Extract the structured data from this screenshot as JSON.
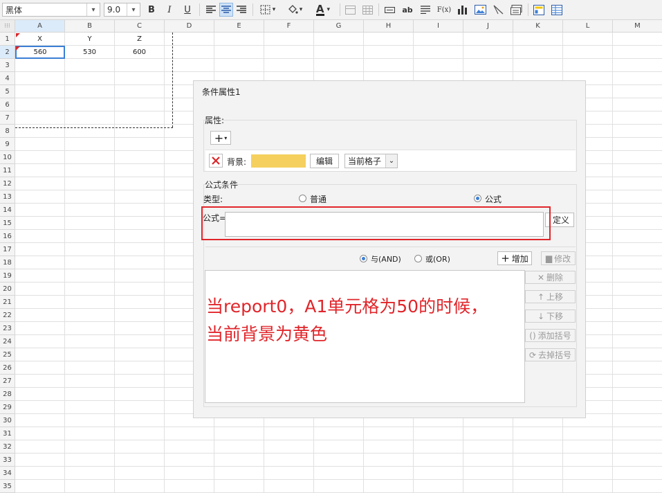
{
  "toolbar": {
    "font_name": "黑体",
    "font_size": "9.0",
    "bold": "B",
    "italic": "I",
    "underline": "U",
    "font_color_glyph": "A",
    "text_tool": "ab",
    "formula_tool": "F(x)"
  },
  "sheet": {
    "columns": [
      "A",
      "B",
      "C",
      "D",
      "E",
      "F",
      "G",
      "H",
      "I",
      "J",
      "K",
      "L",
      "M"
    ],
    "rows": [
      "1",
      "2",
      "3",
      "4",
      "5",
      "6",
      "7",
      "8",
      "9",
      "10",
      "11",
      "12",
      "13",
      "14",
      "15",
      "16",
      "17",
      "18",
      "19",
      "20",
      "21",
      "22",
      "23",
      "24",
      "25",
      "26",
      "27",
      "28",
      "29",
      "30",
      "31",
      "32",
      "33",
      "34",
      "35"
    ],
    "row1": [
      "X",
      "Y",
      "Z"
    ],
    "row2": [
      "560",
      "530",
      "600"
    ]
  },
  "dialog": {
    "title": "条件属性1",
    "attributes_label": "属性:",
    "add_glyph": "+",
    "background_label": "背景:",
    "background_color": "#f5d05e",
    "edit_button": "编辑",
    "scope_select": "当前格子",
    "formula_section_label": "公式条件",
    "type_label": "类型:",
    "type_normal": "普通",
    "type_formula": "公式",
    "formula_label": "公式=",
    "formula_value": "",
    "define_button": "定义",
    "and_label": "与(AND)",
    "or_label": "或(OR)",
    "add_button": "增加",
    "modify_button": "修改",
    "delete_button": "删除",
    "up_button": "上移",
    "down_button": "下移",
    "add_bracket_button": "添加括号",
    "remove_bracket_button": "去掉括号"
  },
  "annotation": {
    "line1": "当report0，A1单元格为50的时候，",
    "line2": "当前背景为黄色",
    "color": "#e0252a"
  },
  "colors": {
    "accent": "#3b7fd6",
    "highlight_box": "#e0252a"
  }
}
